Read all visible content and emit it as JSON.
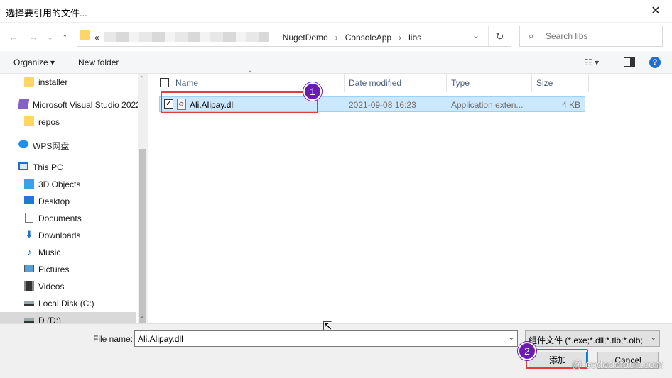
{
  "window": {
    "title": "选择要引用的文件...",
    "close_glyph": "✕"
  },
  "nav": {
    "back_glyph": "←",
    "forward_glyph": "→",
    "recent_glyph": "⌄",
    "up_glyph": "↑"
  },
  "address": {
    "prefix": "«",
    "crumbs": [
      "NugetDemo",
      "ConsoleApp",
      "libs"
    ],
    "separator": "›",
    "dropdown_glyph": "⌄",
    "refresh_glyph": "↻"
  },
  "search": {
    "placeholder": "Search libs",
    "icon": "search-icon"
  },
  "toolbar": {
    "organize": "Organize ▾",
    "new_folder": "New folder",
    "view_glyph": "☷ ▾",
    "help_glyph": "?"
  },
  "sidebar": {
    "items": [
      {
        "label": "installer",
        "icon": "folder-icon"
      },
      {
        "label": "Microsoft Visual Studio 2022",
        "icon": "visual-studio-icon"
      },
      {
        "label": "repos",
        "icon": "folder-icon"
      },
      {
        "label": "WPS网盘",
        "icon": "cloud-icon"
      },
      {
        "label": "This PC",
        "icon": "computer-icon"
      },
      {
        "label": "3D Objects",
        "icon": "cube-icon"
      },
      {
        "label": "Desktop",
        "icon": "desktop-icon"
      },
      {
        "label": "Documents",
        "icon": "documents-icon"
      },
      {
        "label": "Downloads",
        "icon": "download-icon"
      },
      {
        "label": "Music",
        "icon": "music-icon"
      },
      {
        "label": "Pictures",
        "icon": "pictures-icon"
      },
      {
        "label": "Videos",
        "icon": "videos-icon"
      },
      {
        "label": "Local Disk (C:)",
        "icon": "drive-icon"
      },
      {
        "label": "D (D:)",
        "icon": "drive-icon"
      }
    ],
    "scroll_up": "⌃",
    "scroll_down": "⌄"
  },
  "columns": {
    "name": "Name",
    "date": "Date modified",
    "type": "Type",
    "size": "Size",
    "sort_glyph": "^"
  },
  "files": [
    {
      "name": "Ali.Alipay.dll",
      "date": "2021-09-08 16:23",
      "type": "Application exten...",
      "size": "4 KB",
      "checked": "✓"
    }
  ],
  "annotations": {
    "step1": "1",
    "step2": "2"
  },
  "footer": {
    "file_name_label": "File name:",
    "file_name_value": "Ali.Alipay.dll",
    "file_type": "组件文件 (*.exe;*.dll;*.tlb;*.olb;",
    "dropdown_glyph": "⌄",
    "add_button": "添加",
    "cancel_button": "Cancel"
  },
  "watermark": "@ codedefault.com",
  "colors": {
    "selection": "#cce8ff",
    "highlight_box": "#e23c3c",
    "badge": "#6a1bb0"
  }
}
